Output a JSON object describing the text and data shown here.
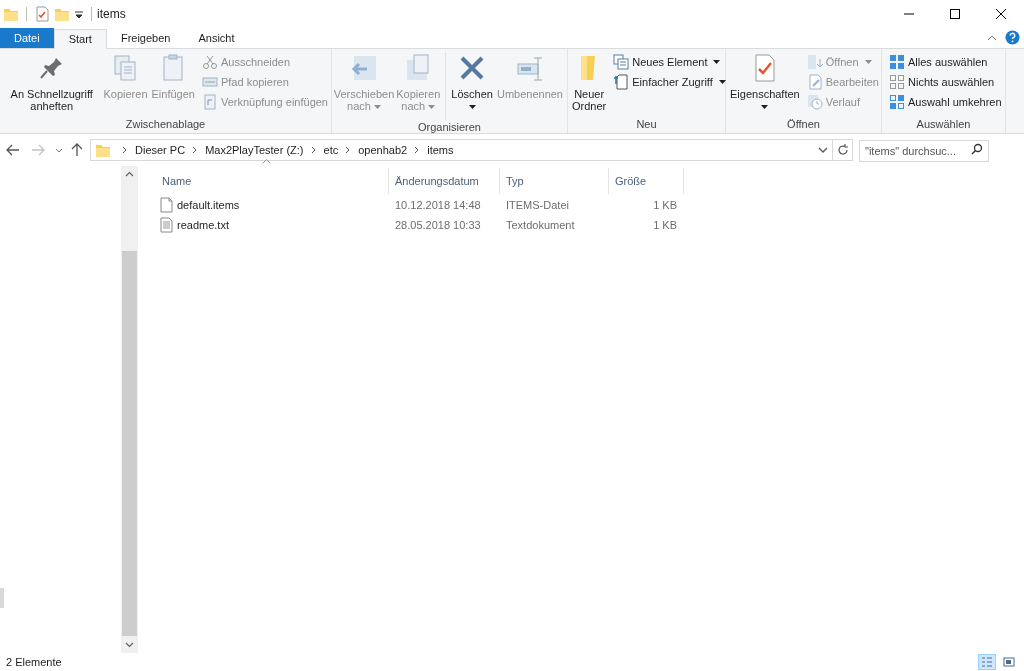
{
  "window": {
    "title": "items"
  },
  "ribbon_tabs": [
    {
      "label": "Datei",
      "kind": "file",
      "selected": false
    },
    {
      "label": "Start",
      "kind": "tab",
      "selected": true
    },
    {
      "label": "Freigeben",
      "kind": "tab",
      "selected": false
    },
    {
      "label": "Ansicht",
      "kind": "tab",
      "selected": false
    }
  ],
  "ribbon_groups": [
    {
      "label": "Zwischenablage",
      "items": [
        {
          "label": "An Schnellzugriff anheften",
          "kind": "large",
          "disabled": false,
          "dropdown": false
        },
        {
          "label": "Kopieren",
          "kind": "large",
          "disabled": true,
          "dropdown": false
        },
        {
          "label": "Einfügen",
          "kind": "large",
          "disabled": true,
          "dropdown": false
        },
        {
          "label": "Ausschneiden",
          "kind": "small",
          "disabled": true,
          "dropdown": false
        },
        {
          "label": "Pfad kopieren",
          "kind": "small",
          "disabled": true,
          "dropdown": false
        },
        {
          "label": "Verknüpfung einfügen",
          "kind": "small",
          "disabled": true,
          "dropdown": false
        }
      ]
    },
    {
      "label": "Organisieren",
      "items": [
        {
          "label": "Verschieben nach",
          "kind": "large",
          "disabled": true,
          "dropdown": true
        },
        {
          "label": "Kopieren nach",
          "kind": "large",
          "disabled": true,
          "dropdown": true
        },
        {
          "label": "Löschen",
          "kind": "large",
          "disabled": false,
          "dropdown": true
        },
        {
          "label": "Umbenennen",
          "kind": "large",
          "disabled": true,
          "dropdown": false
        }
      ]
    },
    {
      "label": "Neu",
      "items": [
        {
          "label": "Neuer Ordner",
          "kind": "large",
          "disabled": false,
          "dropdown": false
        },
        {
          "label": "Neues Element",
          "kind": "small",
          "disabled": false,
          "dropdown": true
        },
        {
          "label": "Einfacher Zugriff",
          "kind": "small",
          "disabled": false,
          "dropdown": true
        }
      ]
    },
    {
      "label": "Öffnen",
      "items": [
        {
          "label": "Eigenschaften",
          "kind": "large",
          "disabled": false,
          "dropdown": true
        },
        {
          "label": "Öffnen",
          "kind": "small",
          "disabled": true,
          "dropdown": true
        },
        {
          "label": "Bearbeiten",
          "kind": "small",
          "disabled": true,
          "dropdown": false
        },
        {
          "label": "Verlauf",
          "kind": "small",
          "disabled": true,
          "dropdown": false
        }
      ]
    },
    {
      "label": "Auswählen",
      "items": [
        {
          "label": "Alles auswählen",
          "kind": "small",
          "disabled": false,
          "dropdown": false
        },
        {
          "label": "Nichts auswählen",
          "kind": "small",
          "disabled": false,
          "dropdown": false
        },
        {
          "label": "Auswahl umkehren",
          "kind": "small",
          "disabled": false,
          "dropdown": false
        }
      ]
    }
  ],
  "address_bar": {
    "path": [
      "Dieser PC",
      "Max2PlayTester (Z:)",
      "etc",
      "openhab2",
      "items"
    ]
  },
  "search": {
    "placeholder": "\"items\" durchsuc..."
  },
  "table": {
    "columns": [
      {
        "label": "Name",
        "sorted": true
      },
      {
        "label": "Änderungsdatum",
        "sorted": false
      },
      {
        "label": "Typ",
        "sorted": false
      },
      {
        "label": "Größe",
        "sorted": false
      }
    ],
    "rows": [
      {
        "kind": "blank",
        "name": "default.items",
        "modified": "10.12.2018 14:48",
        "type": "ITEMS-Datei",
        "size": "1 KB"
      },
      {
        "kind": "text",
        "name": "readme.txt",
        "modified": "28.05.2018 10:33",
        "type": "Textdokument",
        "size": "1 KB"
      }
    ]
  },
  "status_bar": {
    "count": "2 Elemente",
    "views": [
      {
        "kind": "details",
        "selected": true
      },
      {
        "kind": "tiles",
        "selected": false
      }
    ]
  }
}
